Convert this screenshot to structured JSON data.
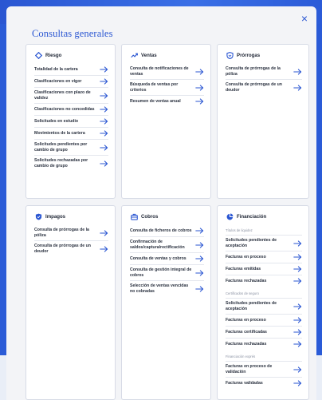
{
  "modal": {
    "title": "Consultas generales",
    "close_label": "×"
  },
  "colors": {
    "accent": "#2a56d2",
    "card_bg": "#ffffff",
    "modal_bg": "#f3f4f7"
  },
  "cards": {
    "riesgo": {
      "title": "Riesgo",
      "icon": "diamond-icon",
      "items": [
        "Totalidad de la cartera",
        "Clasificaciones en vigor",
        "Clasificaciones con plazo de validez",
        "Clasificaciones no concedidas",
        "Solicitudes en estudio",
        "Movimientos de la cartera",
        "Solicitudes pendientes por cambio de grupo",
        "Solicitudes rechazadas por cambio de grupo"
      ]
    },
    "ventas": {
      "title": "Ventas",
      "icon": "trend-up-icon",
      "items": [
        "Consulta de notificaciones de ventas",
        "Búsqueda de ventas por criterios",
        "Resumen de ventas anual"
      ]
    },
    "prorrogas": {
      "title": "Prórrogas",
      "icon": "shield-icon",
      "items": [
        "Consulta de prórrogas de la póliza",
        "Consulta de prórrogas de un deudor"
      ]
    },
    "impagos": {
      "title": "Impagos",
      "icon": "shield-check-icon",
      "items": [
        "Consulta de prórrogas de la póliza",
        "Consulta de prórrogas de un deudor"
      ]
    },
    "cobros": {
      "title": "Cobros",
      "icon": "briefcase-icon",
      "items": [
        "Consulta de ficheros de cobros",
        "Confirmación de saldos/captura/rectificación",
        "Consulta de ventas y cobros",
        "Consulta de gestión integral de cobros",
        "Selección de ventas vencidas no cobradas"
      ]
    },
    "financiacion": {
      "title": "Financiación",
      "icon": "pie-chart-icon",
      "sections": [
        {
          "label": "Títulos de liquidez",
          "items": [
            "Solicitudes pendientes de aceptación",
            "Facturas en proceso",
            "Facturas emitidas",
            "Facturas rechazadas"
          ]
        },
        {
          "label": "Certificados de seguro",
          "items": [
            "Solicitudes pendientes de aceptación",
            "Facturas en proceso",
            "Facturas certificadas",
            "Facturas rechazadas"
          ]
        },
        {
          "label": "Financiación exprés",
          "items": [
            "Facturas en proceso de validación",
            "Facturas validadas"
          ]
        }
      ]
    }
  }
}
